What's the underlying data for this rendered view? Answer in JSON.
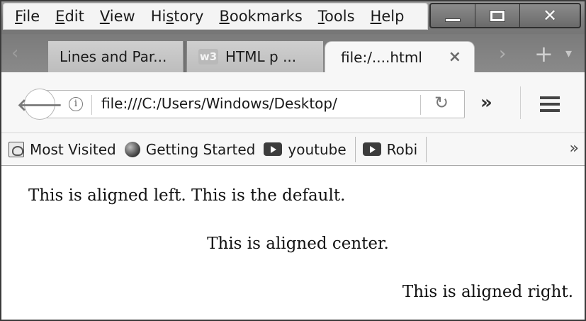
{
  "menu": [
    {
      "pre": "",
      "key": "F",
      "post": "ile"
    },
    {
      "pre": "",
      "key": "E",
      "post": "dit"
    },
    {
      "pre": "",
      "key": "V",
      "post": "iew"
    },
    {
      "pre": "Hi",
      "key": "s",
      "post": "tory"
    },
    {
      "pre": "",
      "key": "B",
      "post": "ookmarks"
    },
    {
      "pre": "",
      "key": "T",
      "post": "ools"
    },
    {
      "pre": "",
      "key": "H",
      "post": "elp"
    }
  ],
  "tabs": [
    {
      "title": "Lines and Par..."
    },
    {
      "title": "HTML p ...",
      "favicon_text": "w3"
    },
    {
      "title": "file:/....html",
      "close": "×",
      "active": true
    }
  ],
  "navbar": {
    "url": "file:///C:/Users/Windows/Desktop/",
    "info_glyph": "i",
    "overflow_glyph": "»"
  },
  "bookmarks": {
    "items": [
      "Most Visited",
      "Getting Started",
      "youtube",
      "Robi"
    ],
    "overflow_glyph": "»"
  },
  "content": {
    "left": "This is aligned left. This is the default.",
    "center": "This is aligned center.",
    "right": "This is aligned right."
  },
  "icons": [
    "minimize-icon",
    "maximize-icon",
    "close-icon",
    "back-arrow-icon",
    "info-icon",
    "reload-icon",
    "overflow-chevron-icon",
    "hamburger-menu-icon",
    "bookmark-page-icon",
    "globe-icon",
    "youtube-play-icon"
  ]
}
